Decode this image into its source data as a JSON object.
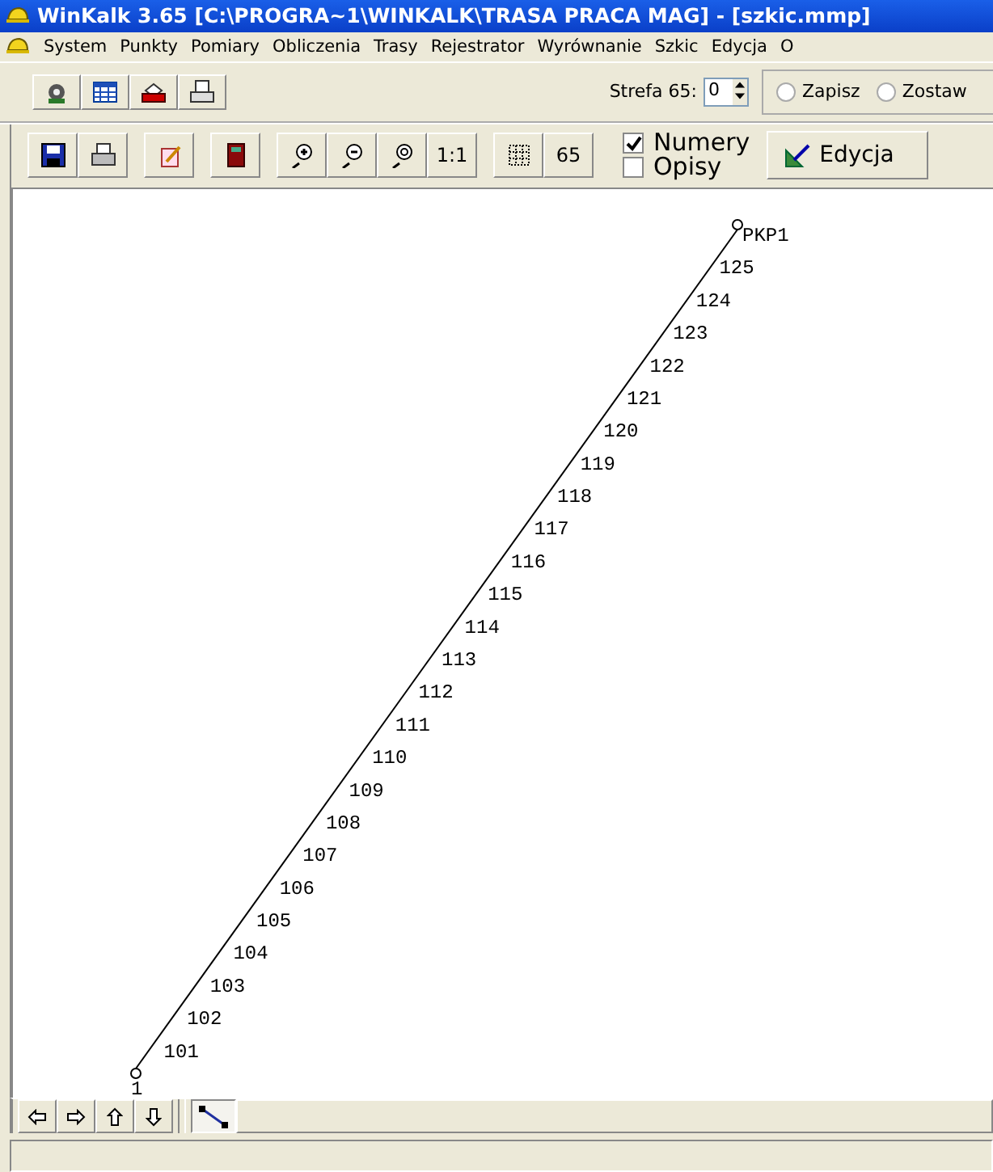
{
  "window": {
    "title": "WinKalk 3.65 [C:\\PROGRA~1\\WINKALK\\TRASA PRACA MAG] - [szkic.mmp]"
  },
  "menu": [
    "System",
    "Punkty",
    "Pomiary",
    "Obliczenia",
    "Trasy",
    "Rejestrator",
    "Wyrównanie",
    "Szkic",
    "Edycja",
    "O"
  ],
  "toolbar_top": {
    "zone_label": "Strefa 65:",
    "zone_value": "0",
    "radios": [
      {
        "label": "Zapisz",
        "selected": false
      },
      {
        "label": "Zostaw",
        "selected": false
      }
    ]
  },
  "toolbar_sketch": {
    "scale_button": "1:1",
    "zone_button": "65",
    "checkboxes": [
      {
        "label": "Numery",
        "checked": true
      },
      {
        "label": "Opisy",
        "checked": false
      }
    ],
    "edit_button": "Edycja"
  },
  "sketch": {
    "start_label": "1",
    "end_label": "PKP1",
    "points": [
      "101",
      "102",
      "103",
      "104",
      "105",
      "106",
      "107",
      "108",
      "109",
      "110",
      "111",
      "112",
      "113",
      "114",
      "115",
      "116",
      "117",
      "118",
      "119",
      "120",
      "121",
      "122",
      "123",
      "124",
      "125"
    ]
  }
}
